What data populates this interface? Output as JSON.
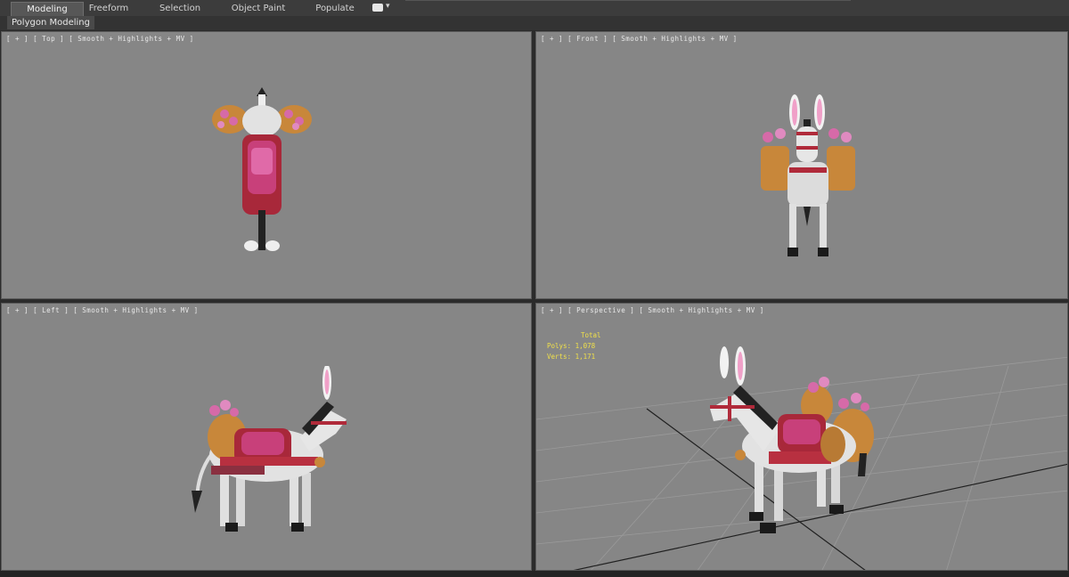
{
  "ribbon": {
    "tabs": [
      "Modeling",
      "Freeform",
      "Selection",
      "Object Paint",
      "Populate"
    ],
    "active_tab": "Modeling",
    "panel_title": "Polygon Modeling"
  },
  "viewports": {
    "top": {
      "label": "[ + ] [ Top ] [ Smooth + Highlights + MV ]"
    },
    "front": {
      "label": "[ + ] [ Front ] [ Smooth + Highlights + MV ]"
    },
    "left": {
      "label": "[ + ] [ Left ] [ Smooth + Highlights + MV ]"
    },
    "perspective": {
      "label": "[ + ] [ Perspective ] [ Smooth + Highlights + MV ]",
      "stats": {
        "total_label": "Total",
        "polys": "Polys:  1,078",
        "verts": "Verts:  1,171"
      }
    }
  },
  "colors": {
    "viewport_bg": "#868686",
    "stats_text": "#f0e04a",
    "saddle_pink": "#c8407a",
    "saddle_red": "#a8283a",
    "basket": "#c8873a"
  }
}
